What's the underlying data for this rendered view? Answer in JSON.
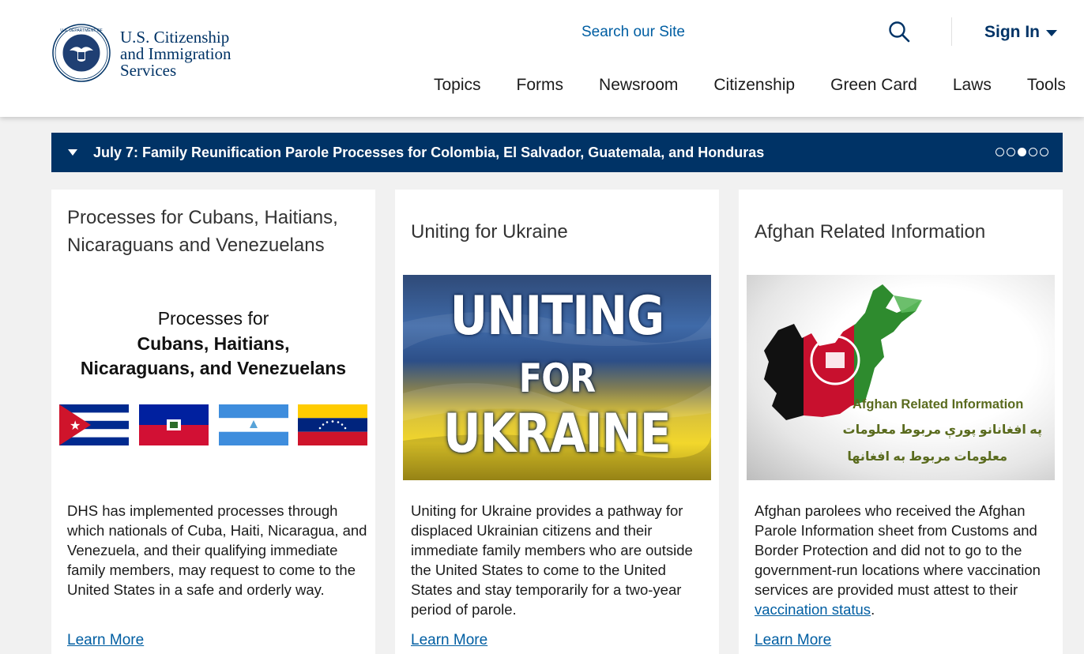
{
  "header": {
    "brand_line1": "U.S. Citizenship",
    "brand_line2": "and Immigration",
    "brand_line3": "Services",
    "search_label": "Search our Site",
    "signin_label": "Sign In",
    "nav": [
      "Topics",
      "Forms",
      "Newsroom",
      "Citizenship",
      "Green Card",
      "Laws",
      "Tools"
    ]
  },
  "alert": {
    "text": "July 7: Family Reunification Parole Processes for Colombia, El Salvador, Guatemala, and Honduras",
    "dot_count": 5,
    "active_dot": 3
  },
  "cards": [
    {
      "title": "Processes for Cubans, Haitians, Nicaraguans and Venezuelans",
      "image": {
        "line1": "Processes for",
        "line2": "Cubans, Haitians,",
        "line3": "Nicaraguans, and Venezuelans"
      },
      "description": "DHS has implemented processes through which nationals of Cuba, Haiti, Nicaragua, and Venezuela, and their qualifying immediate family members, may request to come to the United States in a safe and orderly way.",
      "link": "Learn More"
    },
    {
      "title": "Uniting for Ukraine",
      "image": {
        "line1": "UNITING",
        "line2": "FOR",
        "line3": "UKRAINE"
      },
      "description": "Uniting for Ukraine provides a pathway for displaced Ukrainian citizens and their immediate family members who are outside the United States to come to the United States and stay temporarily for a two-year period of parole.",
      "link": "Learn More"
    },
    {
      "title": "Afghan Related Information",
      "image": {
        "line1": "Afghan Related Information",
        "line2": "په افغانانو پورې مربوط معلومات",
        "line3": "معلومات مربوط به افغانها"
      },
      "description_before": "Afghan parolees who received the Afghan Parole Information sheet from Customs and Border Protection and did not to go to the government-run locations where vaccination services are provided must attest to their ",
      "description_link": "vaccination status",
      "description_after": ".",
      "link": "Learn More"
    }
  ],
  "colors": {
    "navy": "#003366",
    "link": "#005ea2",
    "page_bg": "#f1f1f1"
  },
  "icons": [
    "dhs-seal-icon",
    "search-icon",
    "caret-down-icon",
    "triangle-down-icon"
  ]
}
